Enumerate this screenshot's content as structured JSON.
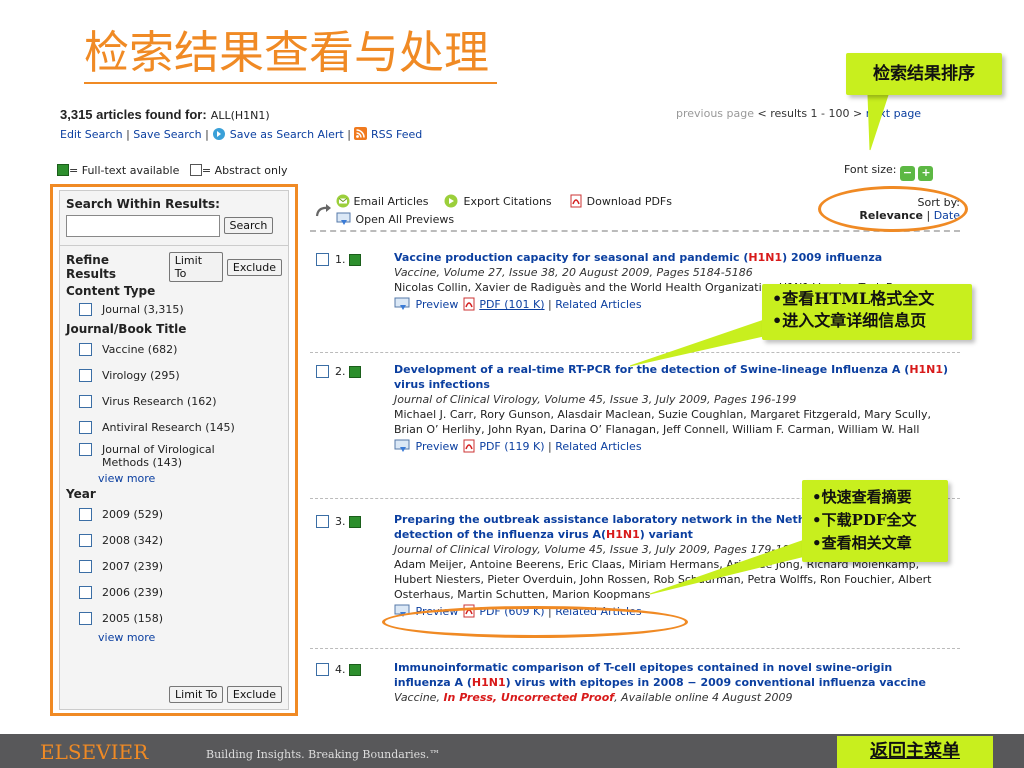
{
  "slide_title": "检索结果查看与处理",
  "callouts": {
    "sort": "检索结果排序",
    "html_lines": [
      "•查看HTML格式全文",
      "•进入文章详细信息页"
    ],
    "preview_lines": [
      "•快速查看摘要",
      "•下载PDF全文",
      "•查看相关文章"
    ]
  },
  "header": {
    "found_count": "3,315 articles found for:",
    "query": "ALL(H1N1)",
    "edit_search": "Edit Search",
    "save_search": "Save Search",
    "save_alert": "Save as Search Alert",
    "rss": "RSS Feed",
    "prev_page": "previous page",
    "results_range": "< results 1 - 100 >",
    "next_page": "next page"
  },
  "legend": {
    "fulltext": "= Full-text available",
    "abstract": "= Abstract only"
  },
  "fontsize_label": "Font size:",
  "sidebar": {
    "search_within": "Search Within Results:",
    "search_button": "Search",
    "refine": "Refine Results",
    "limit_to": "Limit To",
    "exclude": "Exclude",
    "content_type": "Content Type",
    "content_items": [
      "Journal (3,315)"
    ],
    "journal_title": "Journal/Book Title",
    "journal_items": [
      "Vaccine (682)",
      "Virology (295)",
      "Virus Research (162)",
      "Antiviral Research (145)",
      "Journal of Virological Methods (143)"
    ],
    "view_more": "view more",
    "year": "Year",
    "year_items": [
      "2009 (529)",
      "2008 (342)",
      "2007 (239)",
      "2006 (239)",
      "2005 (158)"
    ]
  },
  "toolbar": {
    "email": "Email Articles",
    "export": "Export Citations",
    "download": "Download PDFs",
    "open_previews": "Open All Previews",
    "sort_by": "Sort by:",
    "relevance": "Relevance",
    "date": "Date"
  },
  "results": [
    {
      "num": "1.",
      "title_a": "Vaccine production capacity for seasonal and pandemic (",
      "title_hl": "H1N1",
      "title_b": ") 2009 influenza",
      "source": "Vaccine, Volume 27, Issue 38, 20 August 2009, Pages 5184-5186",
      "authors": "Nicolas Collin, Xavier de Radiguès and the World Health Organization H1N1 Vaccine Task Force",
      "preview": "Preview",
      "pdf": "PDF (101 K)",
      "related": "Related Articles"
    },
    {
      "num": "2.",
      "title_a": "Development of a real-time RT-PCR for the detection of Swine-lineage Influenza A (",
      "title_hl": "H1N1",
      "title_b": ") virus infections",
      "source": "Journal of Clinical Virology, Volume 45, Issue 3, July 2009, Pages 196-199",
      "authors": "Michael J. Carr, Rory Gunson, Alasdair Maclean, Suzie Coughlan, Margaret Fitzgerald, Mary Scully, Brian O’ Herlihy, John Ryan, Darina O’ Flanagan, Jeff Connell, William F. Carman, William W. Hall",
      "preview": "Preview",
      "pdf": "PDF (119 K)",
      "related": "Related Articles"
    },
    {
      "num": "3.",
      "title_a": "Preparing the outbreak assistance laboratory network in the Netherlands for the detection of the influenza virus A(",
      "title_hl": "H1N1",
      "title_b": ") variant",
      "source": "Journal of Clinical Virology, Volume 45, Issue 3, July 2009, Pages 179-184",
      "authors": "Adam Meijer, Antoine Beerens, Eric Claas, Miriam Hermans, Arjan de Jong, Richard Molenkamp, Hubert Niesters, Pieter Overduin, John Rossen, Rob Schuurman, Petra Wolffs, Ron Fouchier, Albert Osterhaus, Martin Schutten, Marion Koopmans",
      "preview": "Preview",
      "pdf": "PDF (609 K)",
      "related": "Related Articles"
    },
    {
      "num": "4.",
      "title_a": "Immunoinformatic comparison of T-cell epitopes contained in novel swine-origin influenza A (",
      "title_hl": "H1N1",
      "title_b": ") virus with epitopes in 2008 − 2009 conventional influenza vaccine",
      "source_a": "Vaccine,",
      "source_hl": "In Press, Uncorrected Proof",
      "source_b": ", Available online 4 August 2009"
    }
  ],
  "footer": {
    "brand": "ELSEVIER",
    "tagline": "Building Insights. Breaking Boundaries.™",
    "back": "返回主菜单"
  }
}
